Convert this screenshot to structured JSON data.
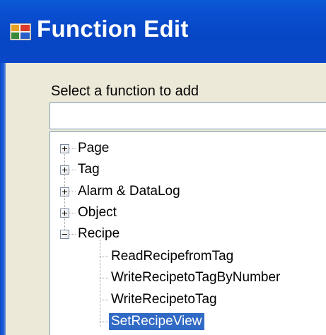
{
  "window": {
    "title": "Function Edit",
    "app_icon": "window-app-icon"
  },
  "form": {
    "prompt_label": "Select a function to add",
    "search_value": "",
    "search_placeholder": ""
  },
  "tree": {
    "categories": [
      {
        "label": "Page",
        "expanded": false
      },
      {
        "label": "Tag",
        "expanded": false
      },
      {
        "label": "Alarm & DataLog",
        "expanded": false
      },
      {
        "label": "Object",
        "expanded": false
      },
      {
        "label": "Recipe",
        "expanded": true
      }
    ],
    "recipe_children": [
      {
        "label": "ReadRecipefromTag",
        "selected": false
      },
      {
        "label": "WriteRecipetoTagByNumber",
        "selected": false
      },
      {
        "label": "WriteRecipetoTag",
        "selected": false
      },
      {
        "label": "SetRecipeView",
        "selected": true
      }
    ]
  },
  "colors": {
    "titlebar": "#0a4fd1",
    "window_face": "#ece9d8",
    "selection": "#316ac5",
    "input_border": "#7f9db9"
  }
}
